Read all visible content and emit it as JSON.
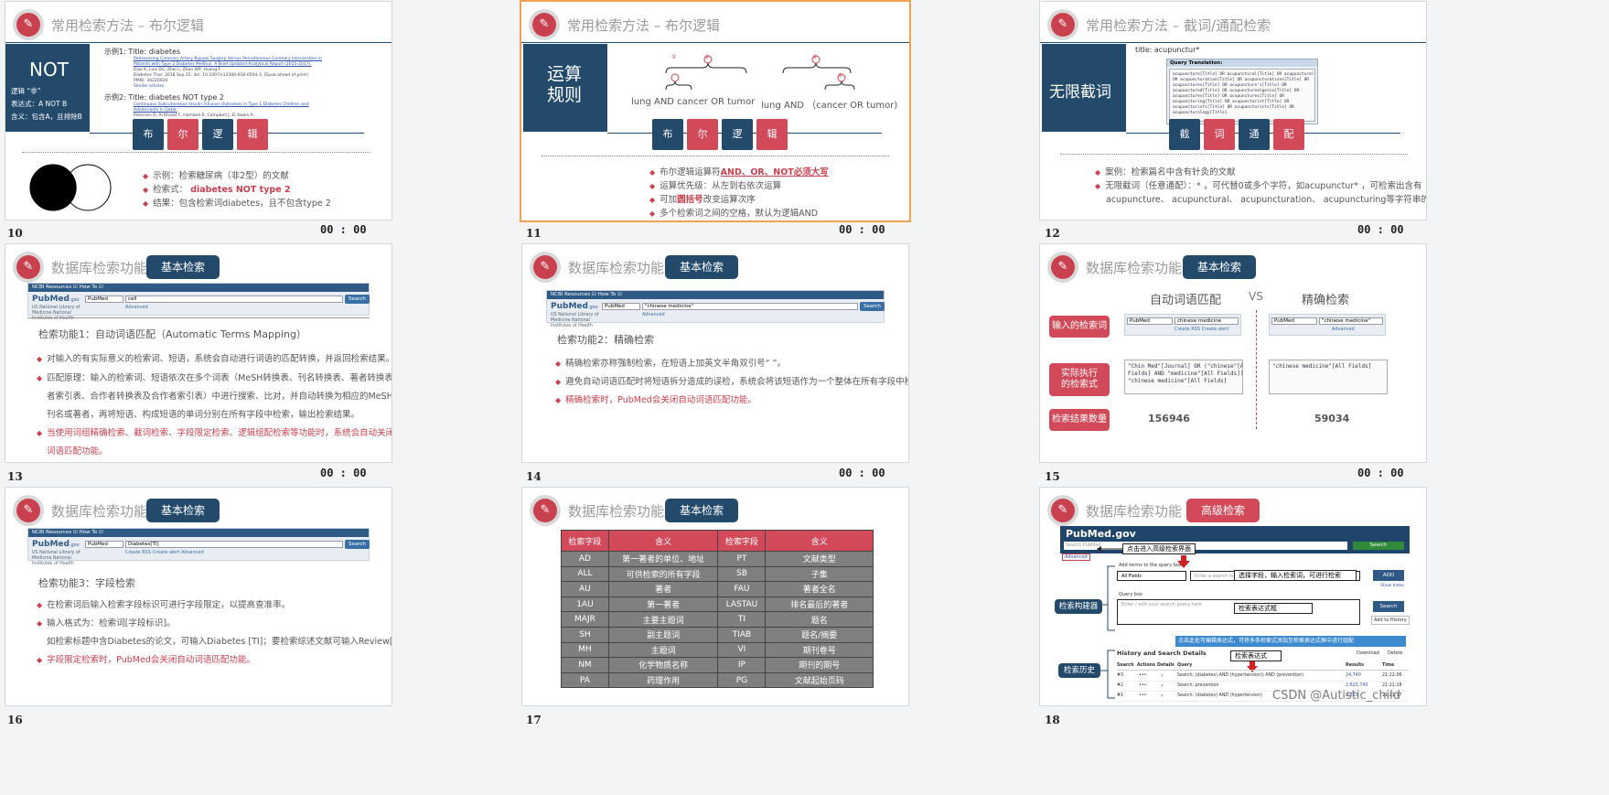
{
  "slides": [
    {
      "number": "10",
      "time": "00 : 00",
      "title": "常用检索方法 – 布尔逻辑",
      "side_big": "NOT",
      "side_lines": [
        "逻辑 “非”",
        "表达式：A NOT B",
        "含义：包含A，且排除B"
      ],
      "example1": "示例1: Title: diabetes",
      "example2": "示例2: Title: diabetes NOT type 2",
      "squares": [
        "布",
        "尔",
        "逻",
        "辑"
      ],
      "bullets": [
        "示例：检索糖尿病（非2型）的文献",
        "检索式：",
        "diabetes NOT type 2",
        "结果：包含检索词diabetes，且不包含type 2"
      ],
      "snippet1": [
        "Reassessing Coronary Artery Bypass Surgery Versus Percutaneous Coronary Intervention in",
        "Patients with Type 2 Diabetes Mellitus: A Brief Updated Analytical Report (2015-2017).",
        "Diaz K, Luis DC, Zhai L, Zhao WP, Huang F.",
        "Diabetes Ther. 2018 Sep 15. doi: 10.1007/s13300-018-0504-3. [Epub ahead of print]",
        "PMID: 30220020",
        "Similar articles"
      ],
      "snippet2": [
        "Continuous Subcutaneous Insulin Infusion Outcomes in Type 1 Diabetes Children and",
        "Adolescents in Qatar.",
        "Petersen D, Al Khalaf F, Hameed R, Campbell J, El Awwa A."
      ]
    },
    {
      "number": "11",
      "time": "00 : 00",
      "title": "常用检索方法 – 布尔逻辑",
      "side_big": "运算\n规则",
      "expr1": "lung AND cancer OR tumor",
      "expr2": "lung AND （cancer OR tumor)",
      "marks": [
        "①",
        "②",
        "②",
        "①"
      ],
      "squares": [
        "布",
        "尔",
        "逻",
        "辑"
      ],
      "bullets_a": "布尔逻辑运算符",
      "bullets_a_red": "AND、OR、NOT必须大写",
      "bullets": [
        "运算优先级：从左到右依次运算",
        "可加",
        "圆括号",
        "改变运算次序",
        "多个检索词之间的空格，默认为逻辑AND"
      ]
    },
    {
      "number": "12",
      "time": "00 : 00",
      "title": "常用检索方法 – 截词/通配检索",
      "side_big": "无限截词",
      "query_label": "title: acupunctur*",
      "qt_header": "Query Translation:",
      "qt_text": "acupuncture[Title] OR acupunctural[Title] OR acupunctural[Title]\nOR acupuncturation[Title] OR acupuncturations[Title] OR\nacupunctures[Title] OR acupuncture's[Title] OR\nacupunctured[Title] OR acupuncturealgesia[Title] OR\nacupunctures[Title] OR acupunctures[Title] OR\nacupuncturing[Title] OR acupuncturist[Title] OR\nacupuncturists[Title] OR acupuncturists[Title] OR\nacupuncturology[Title]",
      "squares": [
        "截",
        "词",
        "通",
        "配"
      ],
      "bullets": [
        "案例：检索篇名中含有针灸的文献",
        "无限截词（任意通配）：* ，可代替0或多个字符，如acupunctur* ，可检索出含有",
        "acupuncture、 acupunctural、 acupuncturation、 acupuncturing等字符串的文献。"
      ]
    },
    {
      "number": "13",
      "time": "00 : 00",
      "title": "数据库检索功能",
      "pill": "基本检索",
      "pm": {
        "bar": "NCBI    Resources ☑    How To ☑",
        "db": "PubMed",
        "query": "cell",
        "go": "Search",
        "links": "Advanced",
        "sub": "US National Library of\nMedicine National\nInstitutes of Health"
      },
      "heading": "检索功能1：自动词语匹配（Automatic Terms Mapping）",
      "bullets": [
        "对输入的有实际意义的检索词、短语，系统会自动进行词语的匹配转换，并返回检索结果。",
        "匹配原理：输入的检索词、短语依次在多个词表（MeSH转换表、刊名转换表、著者转换表、著",
        "者索引表、合作者转换表及合作者索引表）中进行搜索、比对，并自动转换为相应的MeSH词、",
        "刊名或著者，再将短语、构成短语的单词分别在所有字段中检索，输出检索结果。",
        "当使用词组精确检索、截词检索、字段限定检索、逻辑组配检索等功能时，系统会自动关闭自动",
        "词语匹配功能。"
      ]
    },
    {
      "number": "14",
      "time": "00 : 00",
      "title": "数据库检索功能",
      "pill": "基本检索",
      "pm": {
        "bar": "NCBI    Resources ☑    How To ☑",
        "db": "PubMed",
        "query": "\"chinese medicine\"",
        "go": "Search",
        "links": "Advanced",
        "sub": "US National Library of\nMedicine National\nInstitutes of Health"
      },
      "heading": "检索功能2：精确检索",
      "bullets": [
        "精确检索亦称强制检索，在短语上加英文半角双引号“ ”。",
        "避免自动词语匹配时将短语拆分造成的误检，系统会将该短语作为一个整体在所有字段中检索。",
        "精确检索时，PubMed会关闭自动词语匹配功能。"
      ]
    },
    {
      "number": "15",
      "time": "00 : 00",
      "title": "数据库检索功能",
      "pill": "基本检索",
      "col1": "自动词语匹配",
      "vs": "VS",
      "col2": "精确检索",
      "tags": [
        "输入的检索词",
        "实际执行\n的检索式",
        "检索结果数量"
      ],
      "in1_db": "PubMed",
      "in1_q": "chinese medicine",
      "in1_links": "Create RSS    Create alert",
      "in2_db": "PubMed",
      "in2_q": "\"chinese medicine\"",
      "in2_links": "Advanced",
      "ex1": "\"Chin Med\"[Journal] OR (\"chinese\"[All\nFields] AND \"medicine\"[All Fields]) OR\n\"chinese medicine\"[All Fields]",
      "ex2": "\"chinese medicine\"[All Fields]",
      "count1": "156946",
      "count2": "59034"
    },
    {
      "number": "16",
      "title": "数据库检索功能",
      "pill": "基本检索",
      "pm": {
        "bar": "NCBI    Resources ☑    How To ☑",
        "db": "PubMed",
        "query": "Diabetes[TI]",
        "go": "Search",
        "links": "Create RSS    Create alert    Advanced",
        "sub": "US National Library of\nMedicine National\nInstitutes of Health"
      },
      "heading": "检索功能3：字段检索",
      "bullets": [
        "在检索词后输入检索字段标识可进行字段限定，以提高查准率。",
        "输入格式为：检索词[字段标识]。",
        "如检索标题中含Diabetes的论文，可输入Diabetes [TI]；要检索综述文献可输入Review[PT]。",
        "字段限定检索时，PubMed会关闭自动词语匹配功能。"
      ]
    },
    {
      "number": "17",
      "title": "数据库检索功能",
      "pill": "基本检索",
      "table_head": [
        "检索字段",
        "含义",
        "检索字段",
        "含义"
      ],
      "table_rows": [
        [
          "AD",
          "第一著者的单位、地址",
          "PT",
          "文献类型"
        ],
        [
          "ALL",
          "可供检索的所有字段",
          "SB",
          "子集"
        ],
        [
          "AU",
          "著者",
          "FAU",
          "著者全名"
        ],
        [
          "1AU",
          "第一著者",
          "LASTAU",
          "排名最后的著者"
        ],
        [
          "MAJR",
          "主要主题词",
          "TI",
          "题名"
        ],
        [
          "SH",
          "副主题词",
          "TIAB",
          "题名/摘要"
        ],
        [
          "MH",
          "主题词",
          "VI",
          "期刊卷号"
        ],
        [
          "NM",
          "化学物质名称",
          "IP",
          "期刊的期号"
        ],
        [
          "PA",
          "药理作用",
          "PG",
          "文献起始页码"
        ]
      ]
    },
    {
      "number": "18",
      "title": "数据库检索功能",
      "pill": "高级检索",
      "logo": "PubMed.gov",
      "search_ph": "Search PubMed",
      "search_btn": "Search",
      "adv": "Advanced",
      "callout1": "点击进入高级检索界面",
      "builder": "Add terms to the query box",
      "field": "All Fields",
      "term_ph": "Enter a search term",
      "callout2": "选择字段，输入检索词，可进行检索",
      "add": "ADD",
      "show_index": "Show Index",
      "qbox": "Query box",
      "qbox_ph": "Enter / edit your search query here",
      "callout3": "检索表达式框",
      "search2": "Search",
      "add_history": "Add to History",
      "callout4": "点击此处可编辑表达式，可将多条检索式添加至检索表达式框中进行组配",
      "history": "History and Search Details",
      "download": "Download",
      "delete": "Delete",
      "callout5": "检索表达式",
      "label1": "检索构建器",
      "label2": "检索历史",
      "hist_head": [
        "Search",
        "Actions",
        "Details",
        "Query",
        "Results",
        "Time"
      ],
      "hist_rows": [
        [
          "#3",
          "Search: (diabetes) AND (hypertension)) AND (prevention)",
          "24,740",
          "21:22:06"
        ],
        [
          "#2",
          "Search: prevention",
          "2,623,740",
          "21:21:28"
        ],
        [
          "#1",
          "Search: (diabetes) AND (hypertension)",
          "2,813",
          "21:21:17"
        ]
      ],
      "watermark": "CSDN @Autistic_child"
    }
  ]
}
